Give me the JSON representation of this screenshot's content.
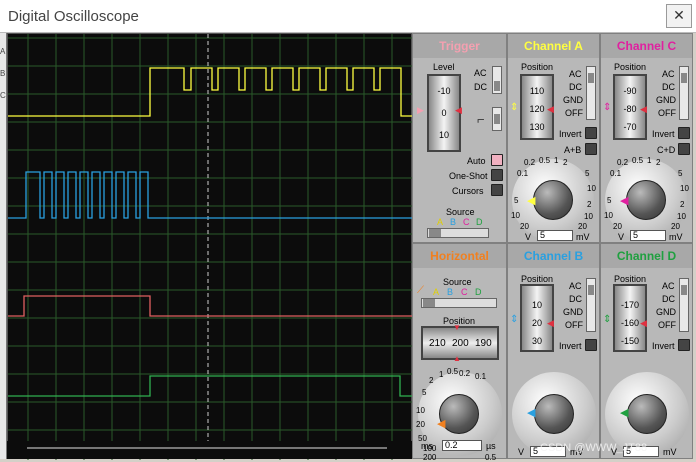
{
  "window": {
    "title": "Digital Oscilloscope",
    "close_glyph": "✕"
  },
  "left_strip": [
    "A",
    "B",
    "C"
  ],
  "trigger": {
    "title": "Trigger",
    "level_label": "Level",
    "level_values": [
      "-10",
      "0",
      "10"
    ],
    "ac": "AC",
    "dc": "DC",
    "auto": "Auto",
    "one_shot": "One-Shot",
    "cursors": "Cursors",
    "source_label": "Source",
    "sources": [
      "A",
      "B",
      "C",
      "D"
    ]
  },
  "horizontal": {
    "title": "Horizontal",
    "source_label": "Source",
    "sources": [
      "A",
      "B",
      "C",
      "D"
    ],
    "position_label": "Position",
    "position_values": [
      "210",
      "200",
      "190"
    ],
    "scale": [
      "0.5",
      "0.2",
      "0.1",
      "1",
      "2",
      "5",
      "10",
      "20",
      "50",
      "100",
      "200",
      "0.5"
    ],
    "left_unit": "ms",
    "value": "0.2",
    "right_unit": "µs"
  },
  "channel_a": {
    "title": "Channel A",
    "color": "#ffff40",
    "position_label": "Position",
    "position_values": [
      "110",
      "120",
      "130"
    ],
    "modes": [
      "AC",
      "DC",
      "GND",
      "OFF"
    ],
    "invert": "Invert",
    "extra": "A+B",
    "scale": [
      "0.2",
      "0.5",
      "1",
      "2",
      "5",
      "10",
      "20",
      "50",
      "0.1",
      "2",
      "5",
      "10",
      "20"
    ],
    "left_unit": "V",
    "value": "5",
    "right_unit": "mV"
  },
  "channel_b": {
    "title": "Channel B",
    "color": "#2aa0e0",
    "position_label": "Position",
    "position_values": [
      "10",
      "20",
      "30"
    ],
    "modes": [
      "AC",
      "DC",
      "GND",
      "OFF"
    ],
    "invert": "Invert",
    "left_unit": "V",
    "value": "5",
    "right_unit": "mV"
  },
  "channel_c": {
    "title": "Channel C",
    "color": "#e020a0",
    "position_label": "Position",
    "position_values": [
      "-90",
      "-80",
      "-70"
    ],
    "modes": [
      "AC",
      "DC",
      "GND",
      "OFF"
    ],
    "invert": "Invert",
    "extra": "C+D",
    "scale": [
      "0.2",
      "0.5",
      "1",
      "2",
      "5",
      "10",
      "20",
      "50",
      "0.1",
      "2",
      "5",
      "10",
      "20"
    ],
    "left_unit": "V",
    "value": "5",
    "right_unit": "mV"
  },
  "channel_d": {
    "title": "Channel D",
    "color": "#20a040",
    "position_label": "Position",
    "position_values": [
      "-170",
      "-160",
      "-150"
    ],
    "modes": [
      "AC",
      "DC",
      "GND",
      "OFF"
    ],
    "invert": "Invert",
    "left_unit": "V",
    "value": "5",
    "right_unit": "mV"
  },
  "watermark": "CSDN @WWW_JT88"
}
